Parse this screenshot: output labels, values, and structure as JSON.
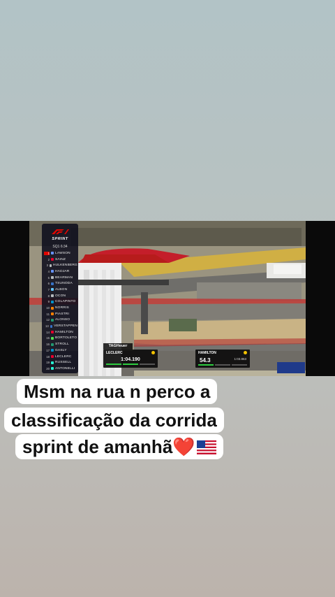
{
  "video": {
    "series_logo": "F1",
    "series_label": "SPRINT",
    "session": "SQ1 6:34",
    "drivers": [
      {
        "pos": "1",
        "name": "LAWSON",
        "team_color": "#6692ff"
      },
      {
        "pos": "2",
        "name": "SAINZ",
        "team_color": "#e8002d"
      },
      {
        "pos": "3",
        "name": "HULKENBERG",
        "team_color": "#b6babd"
      },
      {
        "pos": "4",
        "name": "HADJAR",
        "team_color": "#6692ff"
      },
      {
        "pos": "5",
        "name": "BEARMAN",
        "team_color": "#b6babd"
      },
      {
        "pos": "6",
        "name": "TSUNODA",
        "team_color": "#3671c6"
      },
      {
        "pos": "7",
        "name": "ALBON",
        "team_color": "#64c4ff"
      },
      {
        "pos": "8",
        "name": "OCON",
        "team_color": "#b6babd"
      },
      {
        "pos": "9",
        "name": "COLAPINTO",
        "team_color": "#0093cc"
      },
      {
        "pos": "10",
        "name": "NORRIS",
        "team_color": "#ff8000"
      },
      {
        "pos": "11",
        "name": "PIASTRI",
        "team_color": "#ff8000"
      },
      {
        "pos": "12",
        "name": "ALONSO",
        "team_color": "#229971"
      },
      {
        "pos": "13",
        "name": "VERSTAPPEN",
        "team_color": "#3671c6"
      },
      {
        "pos": "14",
        "name": "HAMILTON",
        "team_color": "#e8002d"
      },
      {
        "pos": "15",
        "name": "BORTOLETO",
        "team_color": "#52e252"
      },
      {
        "pos": "16",
        "name": "STROLL",
        "team_color": "#229971"
      },
      {
        "pos": "17",
        "name": "GASLY",
        "team_color": "#0093cc"
      },
      {
        "pos": "18",
        "name": "LECLERC",
        "team_color": "#e8002d"
      },
      {
        "pos": "19",
        "name": "RUSSELL",
        "team_color": "#27f4d2"
      },
      {
        "pos": "20",
        "name": "ANTONELLI",
        "team_color": "#27f4d2"
      }
    ],
    "sponsor": "TAGHeuer",
    "left_timing": {
      "driver": "LECLERC",
      "tyre": "M",
      "time": "1:04.190"
    },
    "right_timing": {
      "driver": "HAMILTON",
      "tyre": "M",
      "gap": "54.3",
      "lap_time": "1:03.863"
    }
  },
  "caption": {
    "line1": "Msm na rua n perco a",
    "line2": "classificação da corrida",
    "line3": "sprint de amanhã",
    "emoji_heart": "❤️",
    "emoji_flag": "us-flag-icon"
  }
}
